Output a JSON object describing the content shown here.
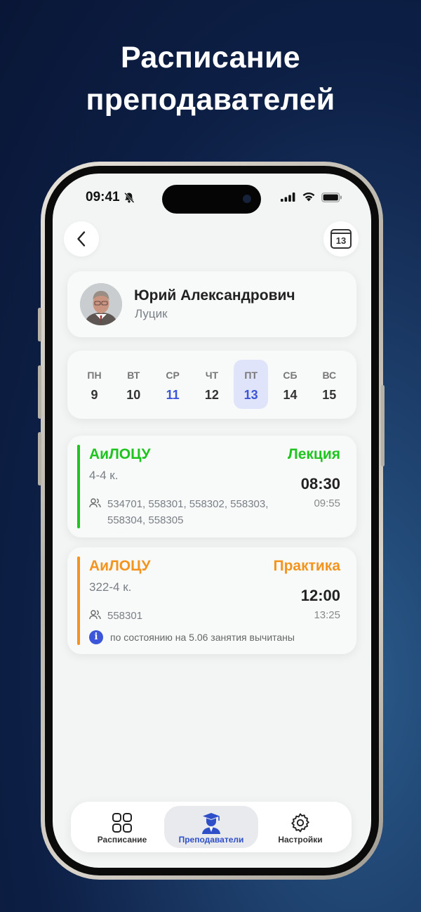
{
  "promo": {
    "title_line1": "Расписание",
    "title_line2": "преподавателей"
  },
  "status_bar": {
    "time": "09:41"
  },
  "header": {
    "calendar_day": "13"
  },
  "teacher": {
    "first_line": "Юрий Александрович",
    "second_line": "Луцик"
  },
  "week": {
    "selected_index": 4,
    "days": [
      {
        "name": "ПН",
        "num": "9"
      },
      {
        "name": "ВТ",
        "num": "10"
      },
      {
        "name": "СР",
        "num": "11"
      },
      {
        "name": "ЧТ",
        "num": "12"
      },
      {
        "name": "ПТ",
        "num": "13"
      },
      {
        "name": "СБ",
        "num": "14"
      },
      {
        "name": "ВС",
        "num": "15"
      }
    ],
    "today_index": 2
  },
  "lessons": [
    {
      "subject": "АиЛОЦУ",
      "type": "Лекция",
      "room": "4-4 к.",
      "start": "08:30",
      "end": "09:55",
      "groups": "534701, 558301, 558302, 558303, 558304, 558305",
      "color": "#1fc41f"
    },
    {
      "subject": "АиЛОЦУ",
      "type": "Практика",
      "room": "322-4 к.",
      "start": "12:00",
      "end": "13:25",
      "groups": "558301",
      "note": "по состоянию на 5.06 занятия вычитаны",
      "color": "#f3941e"
    }
  ],
  "tabs": [
    {
      "label": "Расписание",
      "icon": "grid-icon"
    },
    {
      "label": "Преподаватели",
      "icon": "teacher-icon"
    },
    {
      "label": "Настройки",
      "icon": "gear-icon"
    }
  ],
  "colors": {
    "accent": "#2f4fc8",
    "today": "#3d55d8",
    "lecture": "#1fc41f",
    "practice": "#f3941e"
  }
}
